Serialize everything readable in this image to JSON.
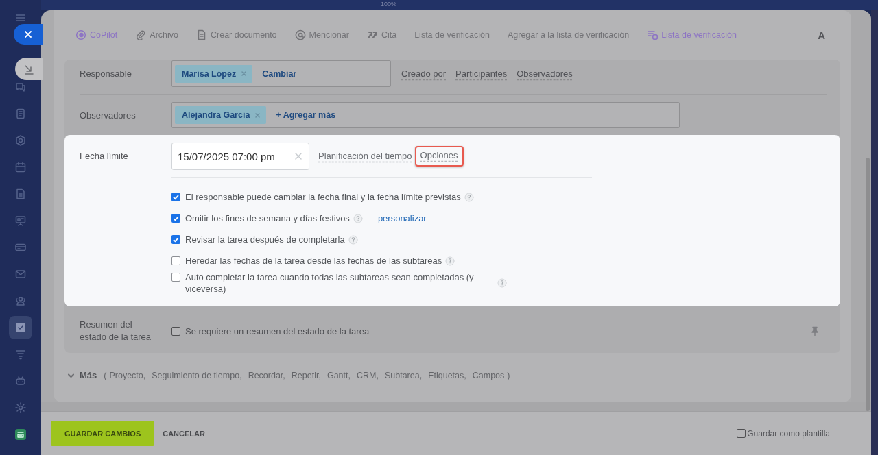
{
  "top_bar": {
    "zoom": "100%"
  },
  "sidebar": {
    "items": [
      {
        "selected": false
      },
      {
        "selected": false
      },
      {
        "selected": false
      },
      {
        "selected": false
      },
      {
        "selected": false
      },
      {
        "selected": false
      },
      {
        "selected": false
      },
      {
        "selected": false
      },
      {
        "selected": false
      },
      {
        "selected": false
      },
      {
        "selected": true
      },
      {
        "selected": false
      },
      {
        "selected": false
      },
      {
        "selected": false
      },
      {
        "selected": false
      }
    ]
  },
  "toolbar": {
    "items": [
      {
        "label": "CoPilot",
        "accent": true
      },
      {
        "label": "Archivo",
        "accent": false
      },
      {
        "label": "Crear documento",
        "accent": false
      },
      {
        "label": "Mencionar",
        "accent": false
      },
      {
        "label": "Cita",
        "accent": false
      },
      {
        "label": "Lista de verificación",
        "accent": false
      },
      {
        "label": "Agregar a la lista de verificación",
        "accent": false
      },
      {
        "label": "Lista de verificación",
        "accent": true
      }
    ],
    "format": "A"
  },
  "responsible": {
    "label": "Responsable",
    "tags": [
      "Marisa López"
    ],
    "action": "Cambiar",
    "links": [
      "Creado por",
      "Participantes",
      "Observadores"
    ]
  },
  "observers": {
    "label": "Observadores",
    "tags": [
      "Alejandra García"
    ],
    "action": "+ Agregar más"
  },
  "deadline": {
    "label": "Fecha límite",
    "value": "15/07/2025 07:00 pm",
    "links": [
      {
        "text": "Planificación del tiempo",
        "highlighted": false
      },
      {
        "text": "Opciones",
        "highlighted": true
      }
    ],
    "options": [
      {
        "text": "El responsable puede cambiar la fecha final y la fecha límite previstas",
        "checked": true
      },
      {
        "text": "Omitir los fines de semana y días festivos",
        "checked": true,
        "link": "personalizar"
      },
      {
        "text": "Revisar la tarea después de completarla",
        "checked": true
      },
      {
        "text": "Heredar las fechas de la tarea desde las fechas de las subtareas",
        "checked": false
      },
      {
        "text": "Auto completar la tarea cuando todas las subtareas sean completadas (y viceversa)",
        "checked": false
      }
    ]
  },
  "summary": {
    "label": "Resumen del estado de la tarea",
    "option": {
      "text": "Se requiere un resumen del estado de la tarea",
      "checked": false
    }
  },
  "more": {
    "label": "Más",
    "open": "(",
    "items": [
      "Proyecto,",
      "Seguimiento de tiempo,",
      "Recordar,",
      "Repetir,",
      "Gantt,",
      "CRM,",
      "Subtarea,",
      "Etiquetas,",
      "Campos"
    ],
    "close": ")"
  },
  "footer": {
    "save": "GUARDAR CAMBIOS",
    "cancel": "CANCELAR",
    "template": {
      "label": "Guardar como plantilla",
      "checked": false
    }
  }
}
